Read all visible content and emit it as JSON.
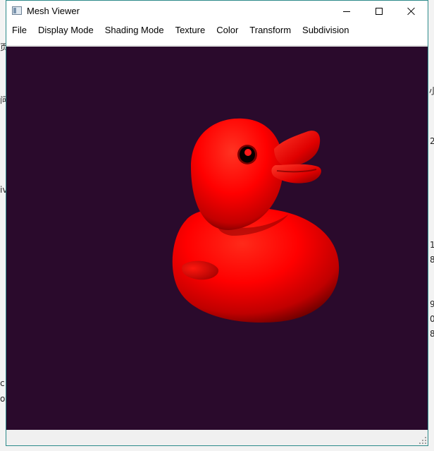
{
  "window": {
    "title": "Mesh Viewer"
  },
  "menu": [
    {
      "label": "File"
    },
    {
      "label": "Display Mode"
    },
    {
      "label": "Shading Mode"
    },
    {
      "label": "Texture"
    },
    {
      "label": "Color"
    },
    {
      "label": "Transform"
    },
    {
      "label": "Subdivision"
    }
  ],
  "viewport": {
    "background": "#2a0a2c",
    "model": "rubber-duck",
    "model_color": "#ff0000"
  },
  "desktop_fragments": {
    "a": "页",
    "b": "问",
    "c": "iv",
    "d": "c",
    "e": "ov",
    "f": "小",
    "g": "2",
    "h": "1",
    "i": "8",
    "j": "9",
    "k": "0",
    "l": "8"
  }
}
